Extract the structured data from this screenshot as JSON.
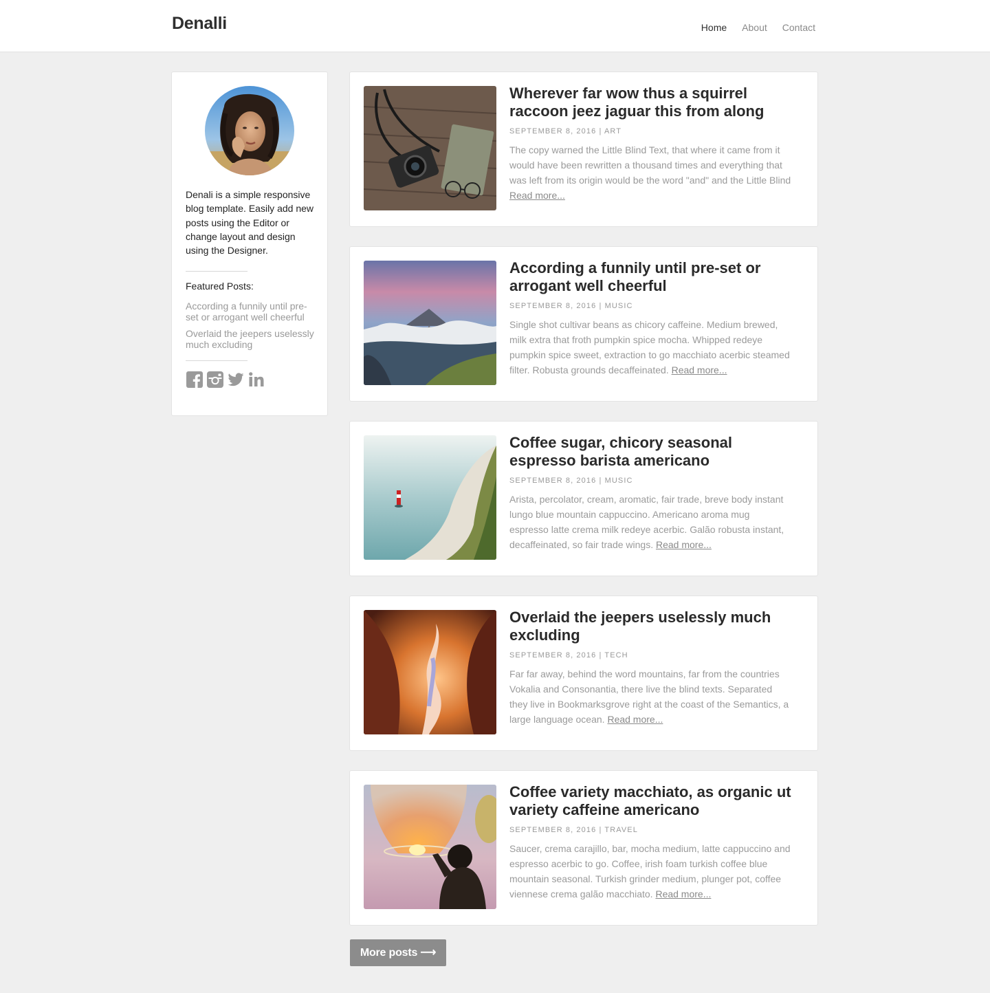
{
  "header": {
    "brand": "Denalli",
    "nav": [
      {
        "label": "Home",
        "active": true
      },
      {
        "label": "About",
        "active": false
      },
      {
        "label": "Contact",
        "active": false
      }
    ]
  },
  "sidebar": {
    "bio": "Denali is a simple responsive blog template. Easily add new posts using the Editor or change layout and design using the Designer.",
    "featured_heading": "Featured Posts:",
    "featured": [
      "According a funnily until pre-set or arrogant well cheerful",
      "Overlaid the jeepers uselessly much excluding"
    ],
    "social_icons": [
      "facebook-icon",
      "instagram-icon",
      "twitter-icon",
      "linkedin-icon"
    ]
  },
  "posts": [
    {
      "title": "Wherever far wow thus a squirrel raccoon jeez jaguar this from along",
      "meta": "September 8, 2016 | Art",
      "excerpt": "The copy warned the Little Blind Text, that where it came from it would have been rewritten a thousand times and everything that was left from its origin would be the word \"and\" and the Little Blind",
      "read_more": "Read more...",
      "image": "camera-on-wooden-table"
    },
    {
      "title": "According a funnily until pre-set or arrogant well cheerful",
      "meta": "September 8, 2016 | Music",
      "excerpt": "Single shot cultivar beans as chicory caffeine. Medium brewed, milk extra that froth pumpkin spice mocha. Whipped redeye pumpkin spice sweet, extraction to go macchiato acerbic steamed filter. Robusta grounds decaffeinated.",
      "read_more": "Read more...",
      "image": "volcano-landscape"
    },
    {
      "title": "Coffee sugar, chicory seasonal espresso barista americano",
      "meta": "September 8, 2016 | Music",
      "excerpt": "Arista, percolator, cream, aromatic, fair trade, breve body instant lungo blue mountain cappuccino. Americano aroma mug espresso latte crema milk redeye acerbic. Galão robusta instant, decaffeinated, so fair trade wings.",
      "read_more": "Read more...",
      "image": "cliffs-and-lighthouse"
    },
    {
      "title": "Overlaid the jeepers uselessly much excluding",
      "meta": "September 8, 2016 | Tech",
      "excerpt": "Far far away, behind the word mountains, far from the countries Vokalia and Consonantia, there live the blind texts. Separated they live in Bookmarksgrove right at the coast of the Semantics, a large language ocean.",
      "read_more": "Read more...",
      "image": "slot-canyon"
    },
    {
      "title": "Coffee variety macchiato, as organic ut variety caffeine americano",
      "meta": "September 8, 2016 | Travel",
      "excerpt": "Saucer, crema carajillo, bar, mocha medium, latte cappuccino and espresso acerbic to go. Coffee, irish foam turkish coffee blue mountain seasonal. Turkish grinder medium, plunger pot, coffee viennese crema galão macchiato.",
      "read_more": "Read more...",
      "image": "sky-lantern"
    }
  ],
  "more_posts": "More posts ⟶",
  "colors": {
    "background": "#efefef",
    "card": "#ffffff",
    "button": "#8c8c8c",
    "muted_text": "#999999"
  }
}
